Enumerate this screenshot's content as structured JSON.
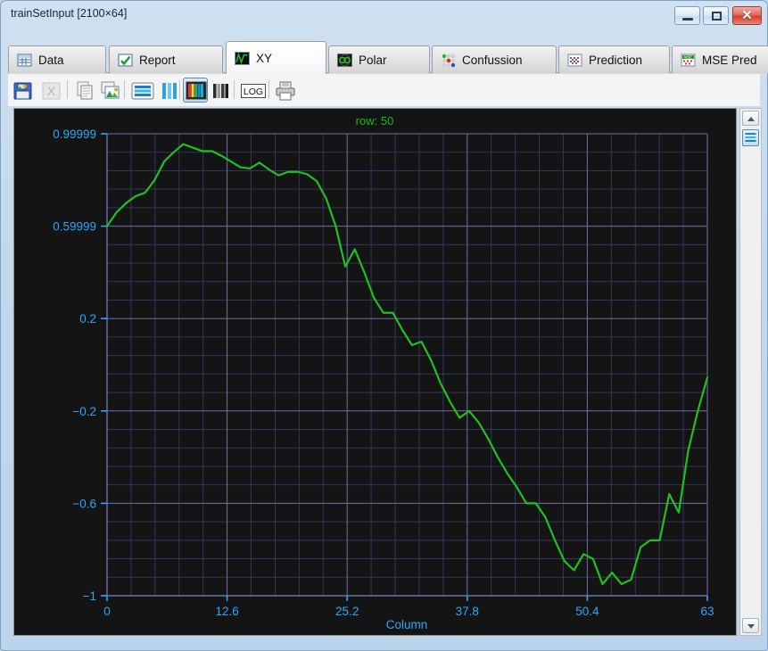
{
  "window": {
    "title": "trainSetInput [2100×64]",
    "buttons": {
      "minimize": "–",
      "maximize": "□",
      "close": "✕"
    }
  },
  "tabs": [
    {
      "label": "Data",
      "icon": "table-icon",
      "active": false
    },
    {
      "label": "Report",
      "icon": "checkmark-icon",
      "active": false
    },
    {
      "label": "XY",
      "icon": "waveform-icon",
      "active": true
    },
    {
      "label": "Polar",
      "icon": "polar-icon",
      "active": false
    },
    {
      "label": "Confussion",
      "icon": "dots-grid-icon",
      "active": false
    },
    {
      "label": "Prediction",
      "icon": "grid-red-icon",
      "active": false
    },
    {
      "label": "MSE Pred",
      "icon": "mse-grid-icon",
      "active": false
    }
  ],
  "toolbar": {
    "buttons": [
      {
        "name": "save-image-icon",
        "enabled": true,
        "pressed": false
      },
      {
        "name": "export-excel-icon",
        "enabled": false,
        "pressed": false
      },
      {
        "name": "copy-data-icon",
        "enabled": true,
        "pressed": false
      },
      {
        "name": "copy-image-icon",
        "enabled": true,
        "pressed": false
      },
      {
        "name": "horizontal-lines-icon",
        "enabled": true,
        "pressed": false
      },
      {
        "name": "vertical-bars-icon",
        "enabled": true,
        "pressed": false
      },
      {
        "name": "color-bars-icon",
        "enabled": true,
        "pressed": true
      },
      {
        "name": "gray-bars-icon",
        "enabled": true,
        "pressed": false
      },
      {
        "name": "log-scale-icon",
        "enabled": true,
        "pressed": false
      },
      {
        "name": "print-icon",
        "enabled": true,
        "pressed": false
      }
    ],
    "log_label": "LOG"
  },
  "side_strip": {
    "up_arrow": "▲",
    "down_arrow": "▼",
    "lines_button": "horizontal-lines-icon"
  },
  "colors": {
    "plot_background": "#141414",
    "grid": "#3b3b6d",
    "axis": "#6f6fa8",
    "tick_label": "#29a8ff",
    "series": "#1fc01f",
    "title": "#12c012"
  },
  "chart_data": {
    "type": "line",
    "title": "row: 50",
    "xlabel": "Column",
    "ylabel": "",
    "grid": true,
    "legend": "none",
    "xlim": [
      0,
      63
    ],
    "ylim": [
      -1,
      0.99999
    ],
    "xticks": [
      0,
      12.6,
      25.2,
      37.8,
      50.4,
      63
    ],
    "xtick_labels": [
      "0",
      "12.6",
      "25.2",
      "37.8",
      "50.4",
      "63"
    ],
    "yticks": [
      0.99999,
      0.59999,
      0.2,
      -0.2,
      -0.6,
      -1
    ],
    "ytick_labels": [
      "0.99999",
      "0.59999",
      "0.2",
      "−0.2",
      "−0.6",
      "−1"
    ],
    "x_minor_ticks": 5,
    "y_minor_ticks": 4,
    "series": [
      {
        "name": "row 50",
        "color": "#1fc01f",
        "x": [
          0,
          1,
          2,
          3,
          4,
          5,
          6,
          7,
          8,
          9,
          10,
          11,
          12,
          13,
          14,
          15,
          16,
          17,
          18,
          19,
          20,
          21,
          22,
          23,
          24,
          25,
          26,
          27,
          28,
          29,
          30,
          31,
          32,
          33,
          34,
          35,
          36,
          37,
          38,
          39,
          40,
          41,
          42,
          43,
          44,
          45,
          46,
          47,
          48,
          49,
          50,
          51,
          52,
          53,
          54,
          55,
          56,
          57,
          58,
          59,
          60,
          61,
          62,
          63
        ],
        "y": [
          0.6,
          0.66,
          0.7,
          0.73,
          0.745,
          0.8,
          0.88,
          0.92,
          0.955,
          0.94,
          0.925,
          0.925,
          0.905,
          0.88,
          0.855,
          0.85,
          0.875,
          0.845,
          0.82,
          0.835,
          0.835,
          0.825,
          0.795,
          0.72,
          0.6,
          0.425,
          0.5,
          0.4,
          0.29,
          0.225,
          0.225,
          0.15,
          0.085,
          0.1,
          0.02,
          -0.08,
          -0.16,
          -0.23,
          -0.2,
          -0.25,
          -0.32,
          -0.4,
          -0.47,
          -0.53,
          -0.6,
          -0.6,
          -0.66,
          -0.76,
          -0.85,
          -0.89,
          -0.82,
          -0.84,
          -0.95,
          -0.9,
          -0.95,
          -0.93,
          -0.79,
          -0.76,
          -0.76,
          -0.56,
          -0.64,
          -0.37,
          -0.2,
          -0.055
        ]
      }
    ]
  }
}
